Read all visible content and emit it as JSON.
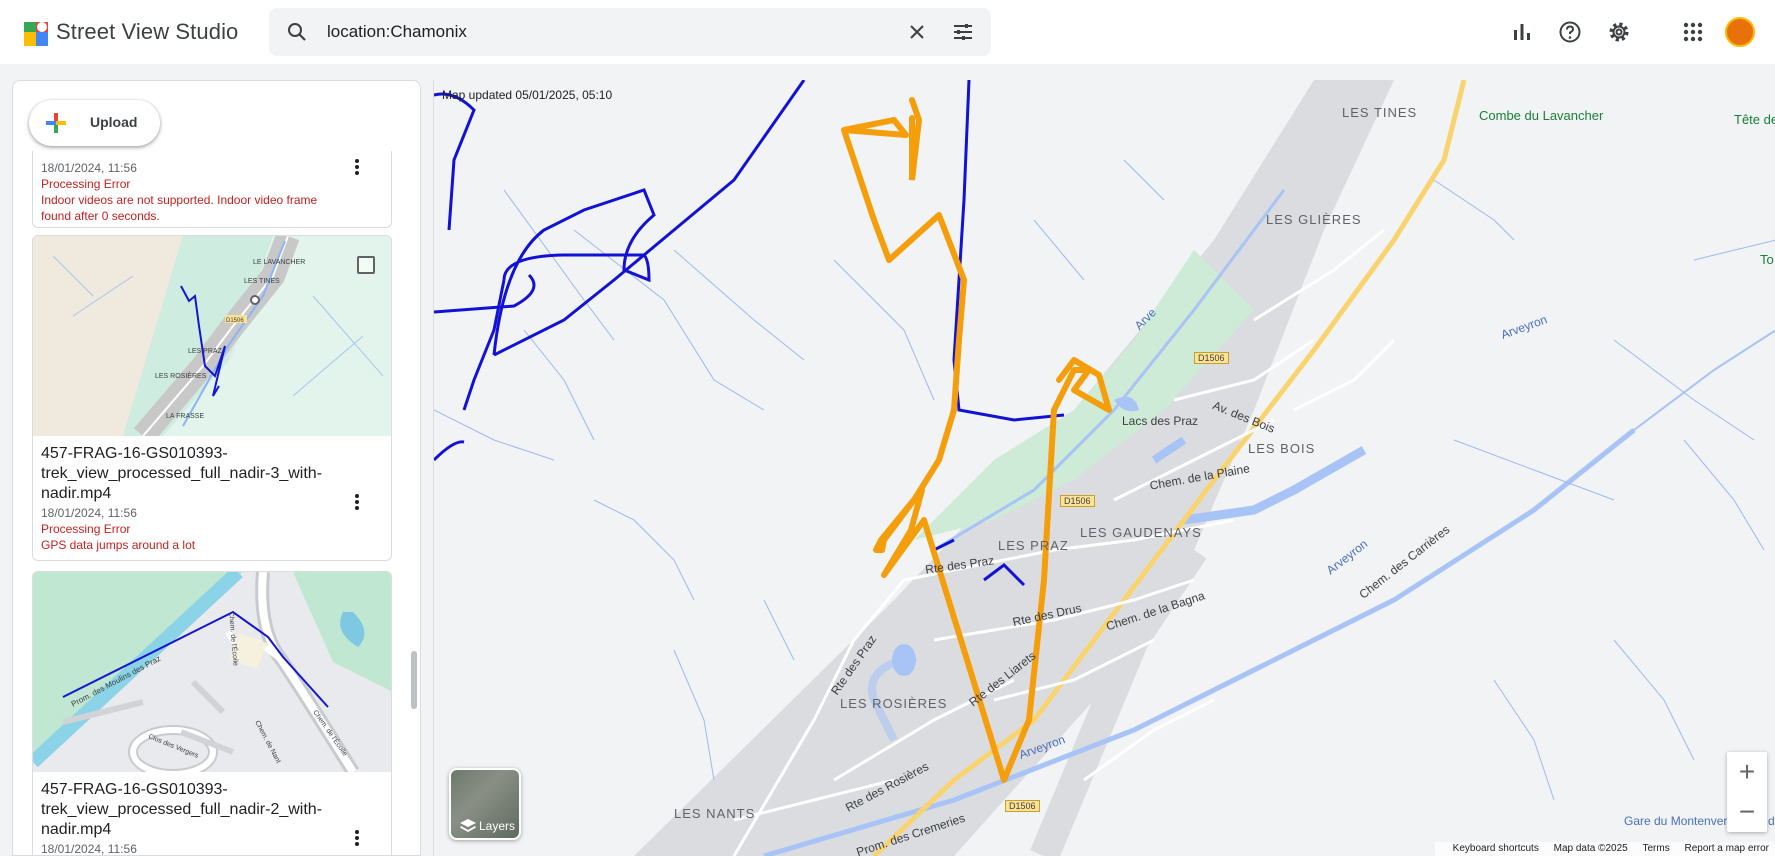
{
  "app": {
    "title": "Street View Studio"
  },
  "search": {
    "value": "location:Chamonix"
  },
  "upload": {
    "label": "Upload"
  },
  "cards": [
    {
      "date": "18/01/2024, 11:56",
      "status": "Processing Error",
      "error": "Indoor videos are not supported. Indoor video frame found after 0 seconds."
    },
    {
      "name": "457-FRAG-16-GS010393-trek_view_processed_full_nadir-3_with-nadir.mp4",
      "date": "18/01/2024, 11:56",
      "status": "Processing Error",
      "error": "GPS data jumps around a lot",
      "thumb_labels": [
        "LE LAVANCHER",
        "LES TINES",
        "D1506",
        "LES PRAZ",
        "LES ROSIÈRES",
        "LA FRASSE"
      ]
    },
    {
      "name": "457-FRAG-16-GS010393-trek_view_processed_full_nadir-2_with-nadir.mp4",
      "date": "18/01/2024, 11:56",
      "thumb_labels": [
        "Prom. des Moulins des Praz",
        "Clos des Vergers",
        "Chem. de Nant",
        "Chem. de l'Écoile",
        "Chem. de l'Écoile"
      ]
    }
  ],
  "map": {
    "updated": "Map updated 05/01/2025, 05:10",
    "places": [
      "LES TINES",
      "Combe du Lavancher",
      "Tête de Prapato",
      "LES GLIÈRES",
      "LES BOIS",
      "LES GAUDENAYS",
      "LES PRAZ",
      "LES ROSIÈRES",
      "LES NANTS",
      "Lacs des Praz",
      "Gare du Montenvers - Mer de Glace",
      "To"
    ],
    "rivers": [
      "Arve",
      "Arveyron",
      "Arveyron",
      "Arveyron"
    ],
    "streets": [
      "Av. des Bois",
      "Chem. de la Plaine",
      "Rte des Praz",
      "Rte des Praz",
      "Rte des Drus",
      "Chem. de la Bagna",
      "Rte des Liarets",
      "Rte des Rosières",
      "Prom. des Cremeries",
      "Chem. des Carrières"
    ],
    "road_tags": [
      "D1506",
      "D1506",
      "D1506"
    ],
    "layers_label": "Layers",
    "zoom_in": "+",
    "zoom_out": "−",
    "attribution": {
      "shortcuts": "Keyboard shortcuts",
      "data": "Map data ©2025",
      "terms": "Terms",
      "report": "Report a map error"
    }
  },
  "colors": {
    "track_orange": "#f59e0b",
    "track_blue": "#0b0bd8",
    "accent": "#1a73e8"
  }
}
